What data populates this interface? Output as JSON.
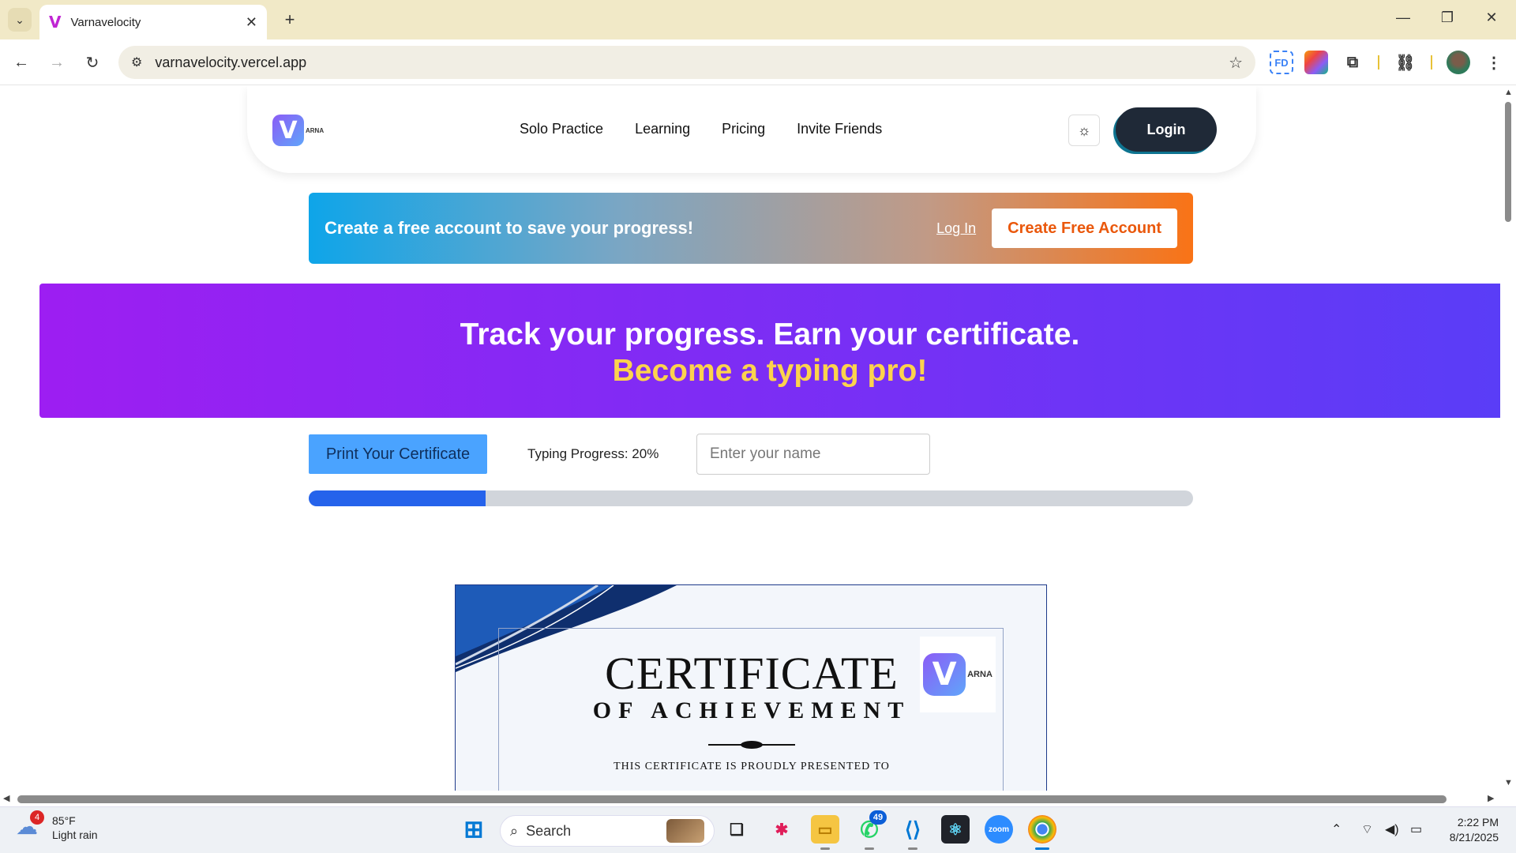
{
  "browser": {
    "tab_title": "Varnavelocity",
    "tab_favicon": "V",
    "url": "varnavelocity.vercel.app",
    "extensions": [
      "FD",
      "color-picker-icon",
      "puzzle-icon",
      "link-icon",
      "profile-avatar"
    ]
  },
  "site": {
    "logo_text": "ARNA",
    "nav_links": [
      "Solo Practice",
      "Learning",
      "Pricing",
      "Invite Friends"
    ],
    "login_label": "Login"
  },
  "banner": {
    "message": "Create a free account to save your progress!",
    "login_link": "Log In",
    "create_button": "Create Free Account"
  },
  "hero": {
    "line1": "Track your progress. Earn your certificate.",
    "line2": "Become a typing pro!"
  },
  "progress": {
    "print_button": "Print Your Certificate",
    "label": "Typing Progress: 20%",
    "value": 0.2,
    "name_placeholder": "Enter your name"
  },
  "certificate": {
    "title": "CERTIFICATE",
    "subtitle": "OF ACHIEVEMENT",
    "presented": "THIS CERTIFICATE IS PROUDLY PRESENTED TO",
    "logo_text": "ARNA"
  },
  "taskbar": {
    "weather_temp": "85°F",
    "weather_desc": "Light rain",
    "weather_badge": "4",
    "search_label": "Search",
    "whatsapp_badge": "49",
    "time": "2:22 PM",
    "date": "8/21/2025"
  },
  "colors": {
    "hero_start": "#9d1ef2",
    "hero_end": "#5a3df7",
    "hero_accent": "#fcd34d",
    "progress_fill": "#2563eb",
    "cta_orange": "#ea580c"
  }
}
